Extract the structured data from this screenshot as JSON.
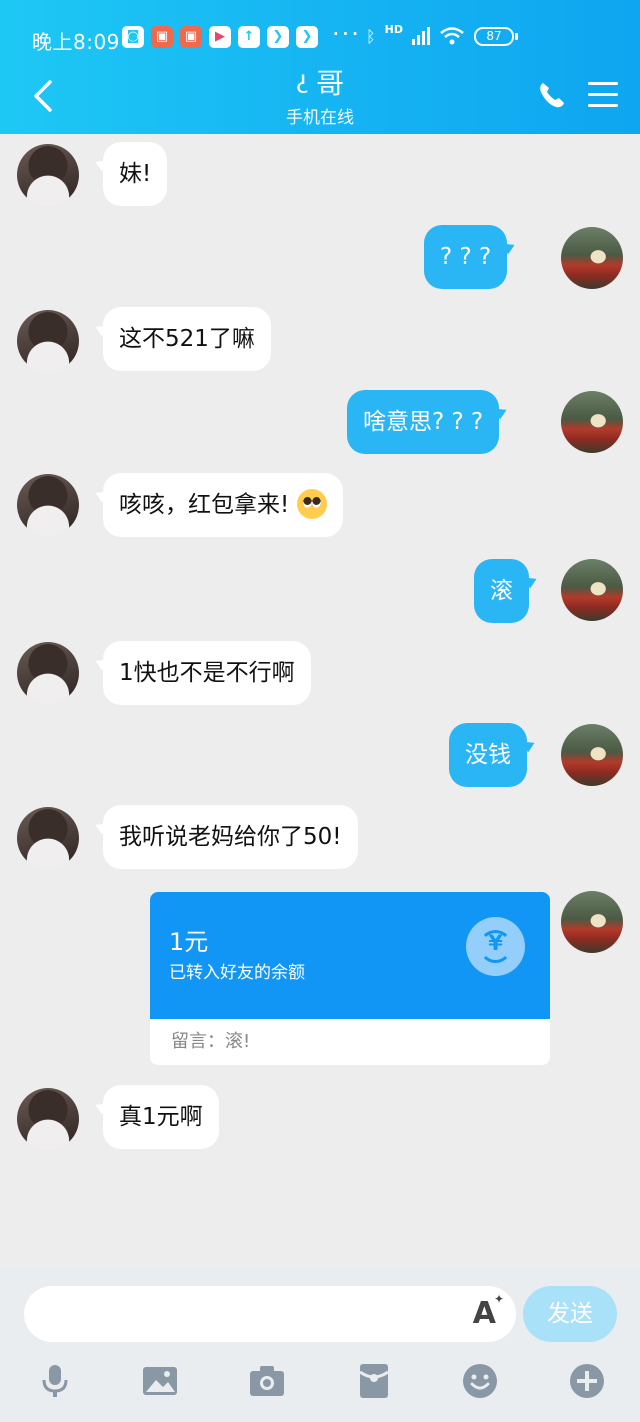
{
  "status_bar": {
    "time": "晚上8:09",
    "network": "HD",
    "battery": "87",
    "more": "···"
  },
  "nav": {
    "title": "哥",
    "subtitle": "手机在线"
  },
  "messages": [
    {
      "side": "in",
      "text": "妹!"
    },
    {
      "side": "out",
      "text": "? ? ?"
    },
    {
      "side": "in",
      "text": "这不521了嘛"
    },
    {
      "side": "out",
      "text": "啥意思? ? ?"
    },
    {
      "side": "in",
      "text": "咳咳，红包拿来!",
      "emoji": "pleading-face-emoji"
    },
    {
      "side": "out",
      "text": "滚"
    },
    {
      "side": "in",
      "text": "1快也不是不行啊"
    },
    {
      "side": "out",
      "text": "没钱"
    },
    {
      "side": "in",
      "text": "我听说老妈给你了50!"
    },
    {
      "side": "in",
      "text": "真1元啊"
    }
  ],
  "transfer": {
    "amount": "1元",
    "description": "已转入好友的余额",
    "note": "留言：滚!",
    "icon": "yen-transfer-icon"
  },
  "input": {
    "placeholder": "",
    "send_label": "发送"
  },
  "colors": {
    "header": "#15b3f2",
    "outgoing_bubble": "#2ab6f5",
    "transfer_card": "#1296f5",
    "send_disabled": "#a9e1f8"
  }
}
